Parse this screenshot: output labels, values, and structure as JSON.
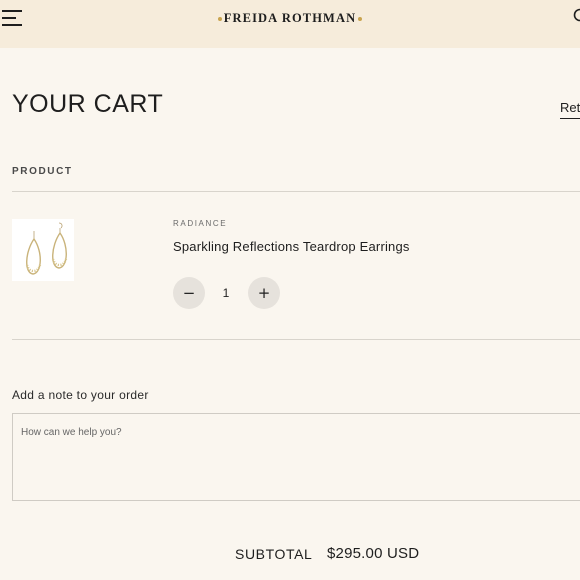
{
  "header": {
    "brand": "FREIDA ROTHMAN",
    "icons": {
      "menu": "hamburger-menu-icon",
      "search": "search-icon"
    },
    "accent_color": "#c9a44f",
    "background": "#f6ecdb"
  },
  "cart": {
    "title": "YOUR CART",
    "return_link": "Retu",
    "column_product": "PRODUCT",
    "items": [
      {
        "collection": "RADIANCE",
        "name": "Sparkling Reflections Teardrop Earrings",
        "quantity": "1",
        "minus_label": "−",
        "plus_label": "+",
        "image": "teardrop-earrings-thumbnail"
      }
    ]
  },
  "note": {
    "label": "Add a note to your order",
    "placeholder": "How can we help you?",
    "value": ""
  },
  "summary": {
    "subtotal_label": "SUBTOTAL",
    "subtotal_value": "$295.00 USD"
  }
}
